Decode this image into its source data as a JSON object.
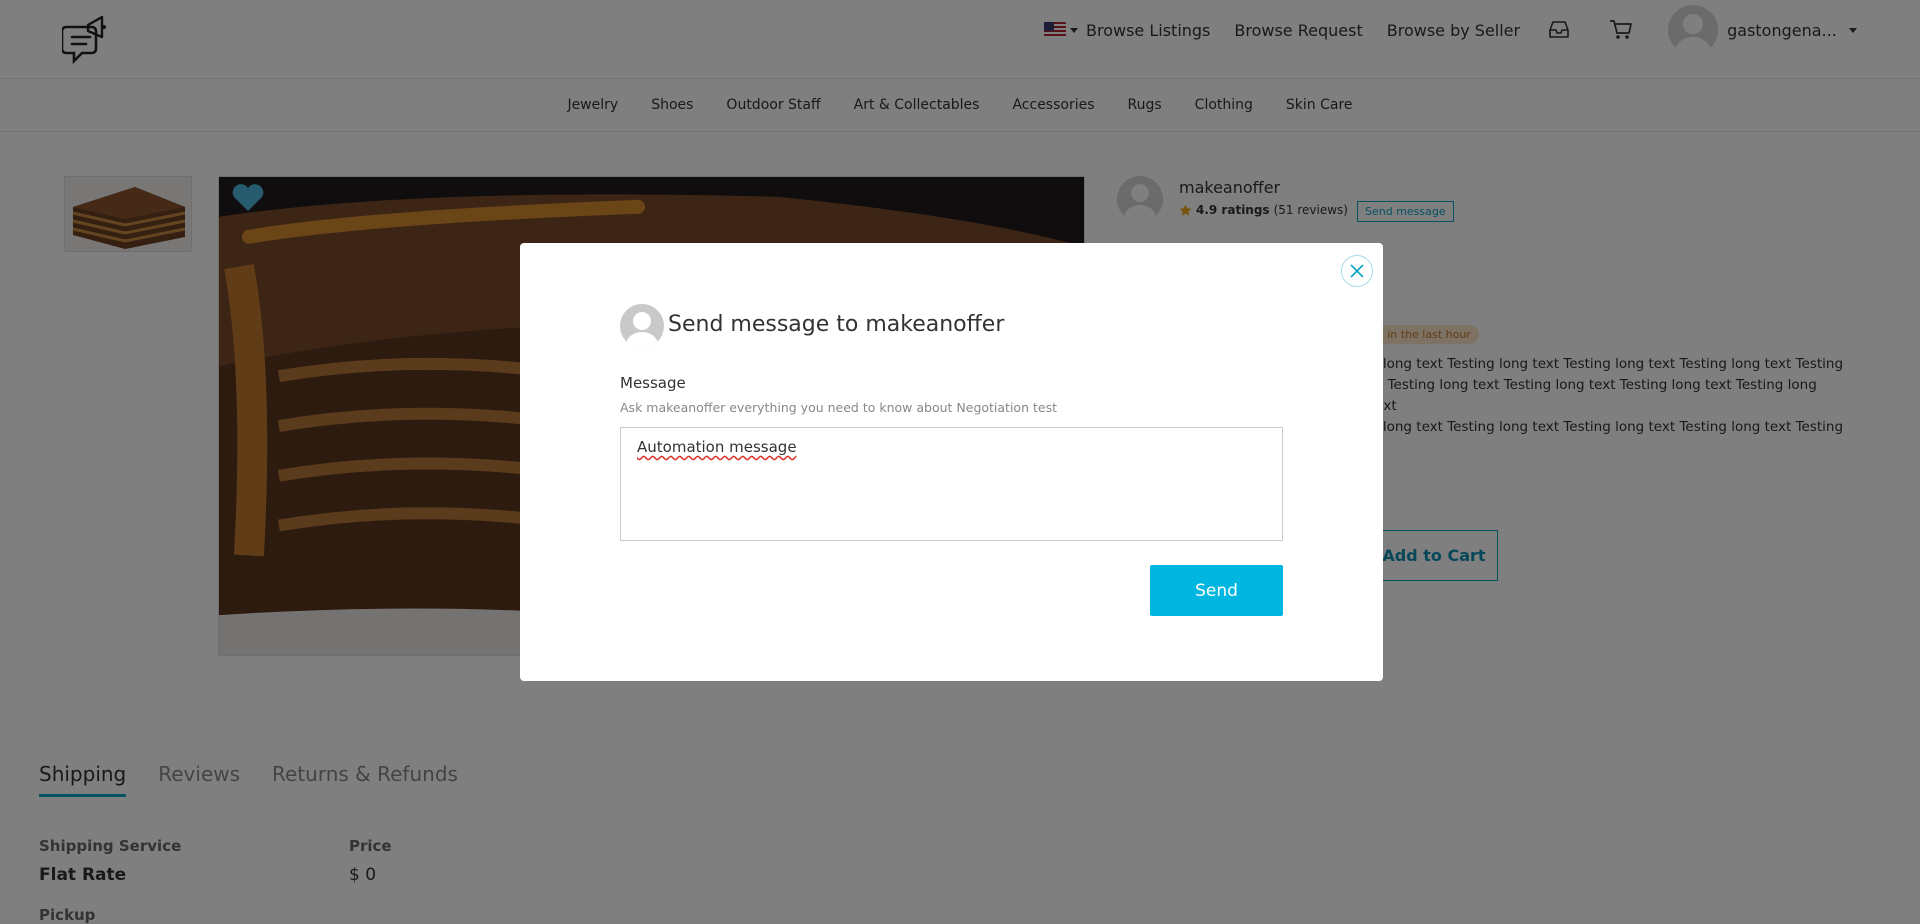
{
  "header": {
    "nav": [
      "Browse Listings",
      "Browse Request",
      "Browse by Seller"
    ],
    "username": "gastongena..."
  },
  "categories": [
    "Jewelry",
    "Shoes",
    "Outdoor Staff",
    "Art & Collectables",
    "Accessories",
    "Rugs",
    "Clothing",
    "Skin Care"
  ],
  "seller": {
    "name": "makeanoffer",
    "rating": "4.9 ratings",
    "reviews": "(51 reviews)",
    "send_message_label": "Send message"
  },
  "product": {
    "badge": "s in the last hour",
    "description_lines": [
      "g long text Testing long text Testing long text Testing long text Testing",
      "xt Testing long text Testing long text Testing long text Testing long text",
      "g long text Testing long text Testing long text Testing long text Testing"
    ],
    "add_to_cart": "Add to Cart"
  },
  "tabs": [
    "Shipping",
    "Reviews",
    "Returns & Refunds"
  ],
  "shipping": {
    "service_header": "Shipping Service",
    "price_header": "Price",
    "service_value": "Flat Rate",
    "price_value": "$ 0",
    "pickup": "Pickup"
  },
  "modal": {
    "title": "Send message to makeanoffer",
    "label": "Message",
    "help": "Ask makeanoffer everything you need to know about Negotiation test",
    "message_value": "Automation message",
    "send_label": "Send"
  },
  "colors": {
    "accent": "#00b6e0",
    "overlay": "rgba(0,0,0,0.5)"
  }
}
